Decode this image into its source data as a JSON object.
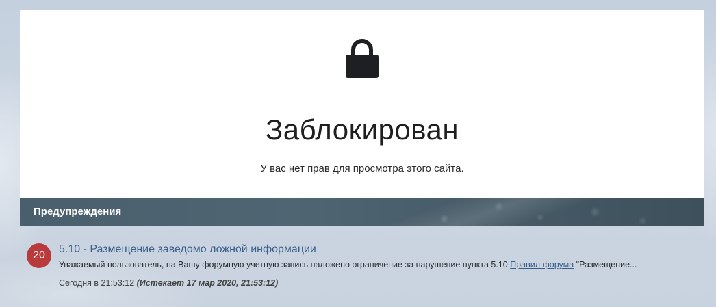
{
  "blocked": {
    "title": "Заблокирован",
    "message": "У вас нет прав для просмотра этого сайта.",
    "icon": "lock-icon"
  },
  "warnings": {
    "header": "Предупреждения",
    "items": [
      {
        "points": "20",
        "title": "5.10 - Размещение заведомо ложной информации",
        "text_before": "Уважаемый пользователь, на Вашу форумную учетную запись наложено ограничение за нарушение пункта 5.10 ",
        "link_text": "Правил форума",
        "text_after": " \"Размещение...",
        "date": "Сегодня в 21:53:12",
        "expires": "(Истекает 17 мар 2020, 21:53:12)"
      }
    ]
  },
  "colors": {
    "badge": "#b93a3a",
    "link": "#3a5d8c",
    "header_bg": "#4a5f6d"
  }
}
